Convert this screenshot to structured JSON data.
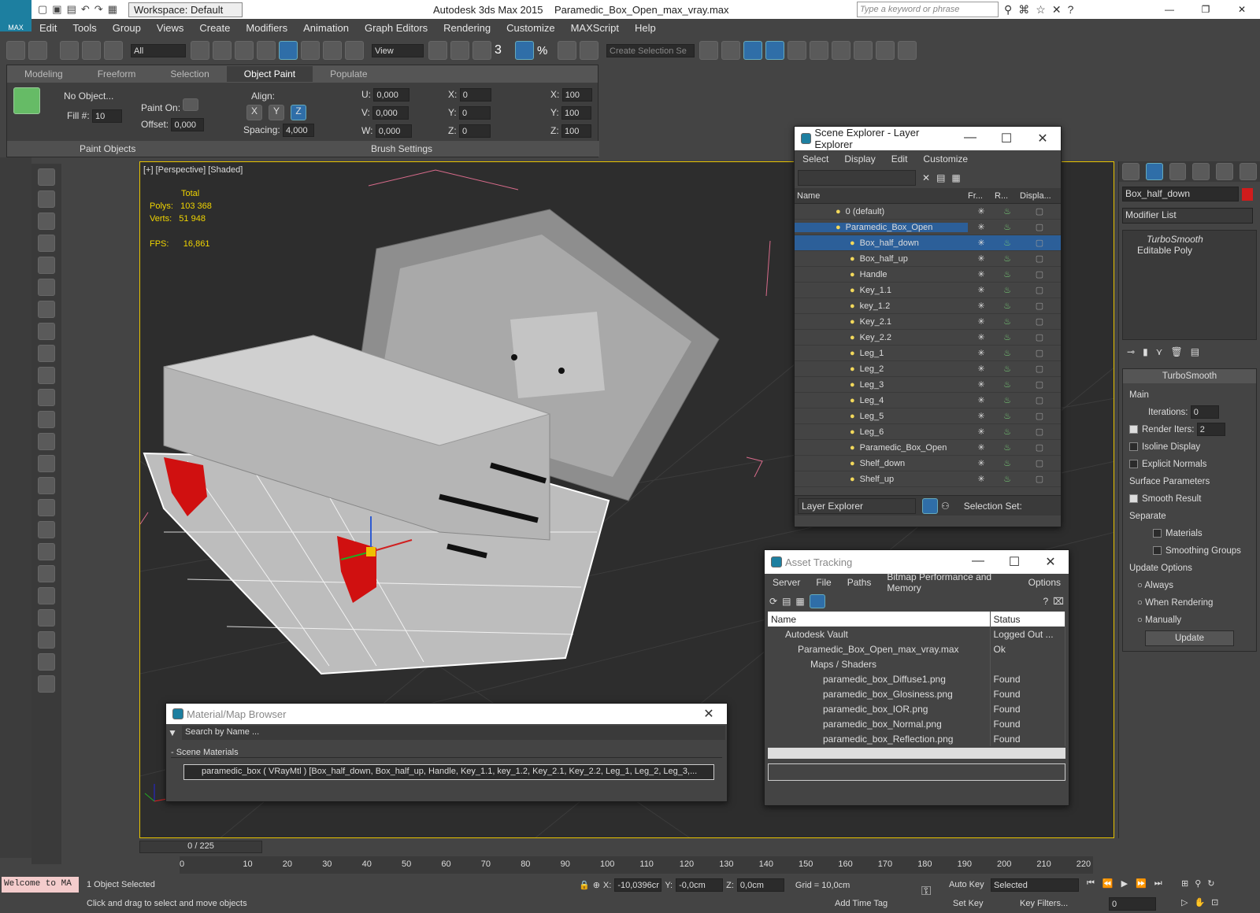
{
  "app": {
    "title": "Autodesk 3ds Max  2015",
    "file": "Paramedic_Box_Open_max_vray.max",
    "workspace": "Workspace: Default",
    "search_placeholder": "Type a keyword or phrase",
    "logo": "MAX"
  },
  "menu": [
    "Edit",
    "Tools",
    "Group",
    "Views",
    "Create",
    "Modifiers",
    "Animation",
    "Graph Editors",
    "Rendering",
    "Customize",
    "MAXScript",
    "Help"
  ],
  "toolbar": {
    "filter": "All",
    "refcoord": "View",
    "selset": "Create Selection Se",
    "snap3": "3",
    "snap_pct": "%"
  },
  "ribbon": {
    "tabs": [
      "Modeling",
      "Freeform",
      "Selection",
      "Object Paint",
      "Populate"
    ],
    "active_tab": "Object Paint",
    "no_object": "No Object...",
    "paint_on": "Paint On:",
    "offset": "Offset:",
    "offset_val": "0,000",
    "fill": "Fill #:",
    "fill_val": "10",
    "align": "Align:",
    "x": "X",
    "y": "Y",
    "z": "Z",
    "spacing": "Spacing:",
    "spacing_val": "4,000",
    "u": "U:",
    "v": "V:",
    "w": "W:",
    "uv": "0,000",
    "rx": "X:",
    "ry": "Y:",
    "rz": "Z:",
    "rv": "0",
    "sx": "X:",
    "sy": "Y:",
    "sz": "Z:",
    "sv": "100",
    "paint_objects": "Paint Objects",
    "brush_settings": "Brush Settings"
  },
  "viewport": {
    "label": "[+] [Perspective] [Shaded]",
    "total": "Total",
    "polys_label": "Polys:",
    "polys": "103 368",
    "verts_label": "Verts:",
    "verts": "51 948",
    "fps_label": "FPS:",
    "fps": "16,861"
  },
  "scene_explorer": {
    "title": "Scene Explorer - Layer Explorer",
    "menu": [
      "Select",
      "Display",
      "Edit",
      "Customize"
    ],
    "cols": [
      "Name",
      "Fr...",
      "R...",
      "Displa..."
    ],
    "rows": [
      {
        "name": "0 (default)",
        "indent": 0,
        "sel": false
      },
      {
        "name": "Paramedic_Box_Open",
        "indent": 0,
        "sel": false,
        "hl": true
      },
      {
        "name": "Box_half_down",
        "indent": 1,
        "sel": true
      },
      {
        "name": "Box_half_up",
        "indent": 1
      },
      {
        "name": "Handle",
        "indent": 1
      },
      {
        "name": "Key_1.1",
        "indent": 1
      },
      {
        "name": "key_1.2",
        "indent": 1
      },
      {
        "name": "Key_2.1",
        "indent": 1
      },
      {
        "name": "Key_2.2",
        "indent": 1
      },
      {
        "name": "Leg_1",
        "indent": 1
      },
      {
        "name": "Leg_2",
        "indent": 1
      },
      {
        "name": "Leg_3",
        "indent": 1
      },
      {
        "name": "Leg_4",
        "indent": 1
      },
      {
        "name": "Leg_5",
        "indent": 1
      },
      {
        "name": "Leg_6",
        "indent": 1
      },
      {
        "name": "Paramedic_Box_Open",
        "indent": 1
      },
      {
        "name": "Shelf_down",
        "indent": 1
      },
      {
        "name": "Shelf_up",
        "indent": 1
      }
    ],
    "footer_mode": "Layer Explorer",
    "selection_set": "Selection Set:"
  },
  "asset_tracking": {
    "title": "Asset Tracking",
    "menu": [
      "Server",
      "File",
      "Paths",
      "Bitmap Performance and Memory",
      "Options"
    ],
    "cols": [
      "Name",
      "Status"
    ],
    "rows": [
      {
        "name": "Autodesk Vault",
        "status": "Logged Out ...",
        "indent": 1
      },
      {
        "name": "Paramedic_Box_Open_max_vray.max",
        "status": "Ok",
        "indent": 2
      },
      {
        "name": "Maps / Shaders",
        "status": "",
        "indent": 3
      },
      {
        "name": "paramedic_box_Diffuse1.png",
        "status": "Found",
        "indent": 4
      },
      {
        "name": "paramedic_box_Glosiness.png",
        "status": "Found",
        "indent": 4
      },
      {
        "name": "paramedic_box_IOR.png",
        "status": "Found",
        "indent": 4
      },
      {
        "name": "paramedic_box_Normal.png",
        "status": "Found",
        "indent": 4
      },
      {
        "name": "paramedic_box_Reflection.png",
        "status": "Found",
        "indent": 4
      }
    ]
  },
  "material_browser": {
    "title": "Material/Map Browser",
    "search_placeholder": "Search by Name ...",
    "section": "- Scene Materials",
    "item": "paramedic_box  ( VRayMtl )  [Box_half_down, Box_half_up, Handle, Key_1.1, key_1.2, Key_2.1, Key_2.2, Leg_1, Leg_2, Leg_3,..."
  },
  "command_panel": {
    "object_name": "Box_half_down",
    "modifier_list": "Modifier List",
    "stack": [
      "TurboSmooth",
      "Editable Poly"
    ],
    "rollout": "TurboSmooth",
    "main": "Main",
    "iterations_label": "Iterations:",
    "iterations": "0",
    "render_iters_label": "Render Iters:",
    "render_iters": "2",
    "isoline": "Isoline Display",
    "explicit": "Explicit Normals",
    "surface": "Surface Parameters",
    "smooth_result": "Smooth Result",
    "separate": "Separate",
    "materials": "Materials",
    "smoothing": "Smoothing Groups",
    "update_options": "Update Options",
    "always": "Always",
    "when_rendering": "When Rendering",
    "manually": "Manually",
    "update": "Update"
  },
  "timeline": {
    "frame": "0 / 225",
    "ticks": [
      "0",
      "10",
      "20",
      "30",
      "40",
      "50",
      "60",
      "70",
      "80",
      "90",
      "100",
      "110",
      "120",
      "130",
      "140",
      "150",
      "160",
      "170",
      "180",
      "190",
      "200",
      "210",
      "220"
    ]
  },
  "status": {
    "maxscript": "Welcome to MA",
    "selected": "1 Object Selected",
    "prompt": "Click and drag to select and move objects",
    "x_label": "X:",
    "x": "-10,0396cr",
    "y_label": "Y:",
    "y": "-0,0cm",
    "z_label": "Z:",
    "z": "0,0cm",
    "grid": "Grid = 10,0cm",
    "auto_key": "Auto Key",
    "set_key": "Set Key",
    "key_mode": "Selected",
    "key_filters": "Key Filters...",
    "add_time_tag": "Add Time Tag",
    "frame": "0"
  }
}
